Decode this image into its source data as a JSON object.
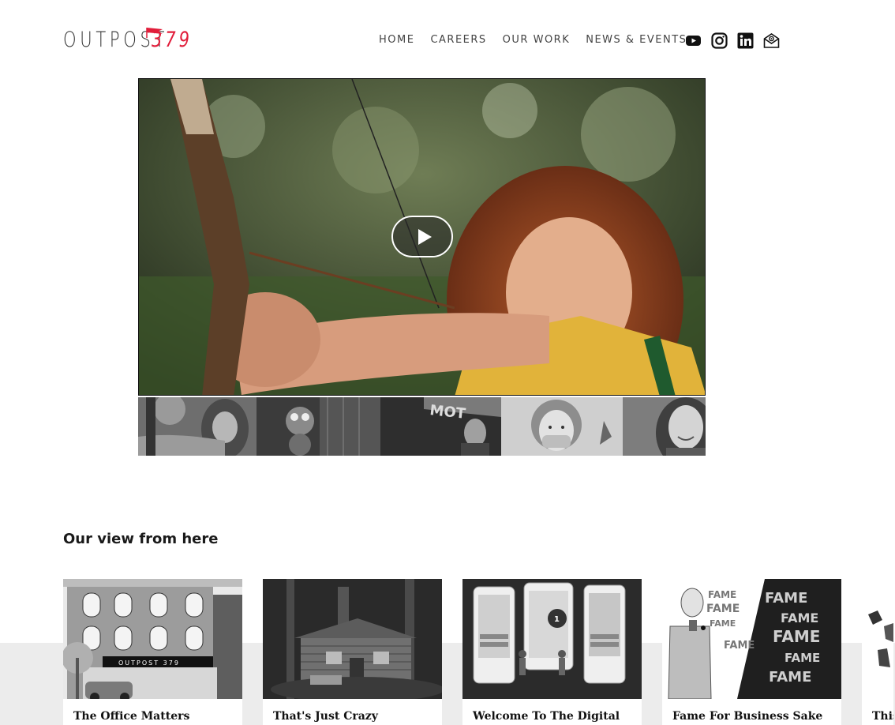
{
  "header": {
    "logo_word": "OUTPOST",
    "logo_number": "379",
    "nav": [
      "HOME",
      "CAREERS",
      "OUR WORK",
      "NEWS & EVENTS"
    ],
    "social_icons": [
      "youtube-icon",
      "instagram-icon",
      "linkedin-icon",
      "newsletter-icon"
    ]
  },
  "video": {
    "play_icon": "play-icon",
    "thumbnails": [
      "archery-girl",
      "cartoon-character",
      "motel-man",
      "masked-child",
      "smiling-woman"
    ]
  },
  "section": {
    "title": "Our view from here",
    "cards": [
      {
        "title": "The Office Matters"
      },
      {
        "title": "That's Just Crazy"
      },
      {
        "title": "Welcome To The Digital"
      },
      {
        "title": "Fame For Business Sake"
      },
      {
        "title": "This"
      }
    ]
  },
  "colors": {
    "brand_red": "#e11d3a",
    "band_grey": "#ececec"
  }
}
